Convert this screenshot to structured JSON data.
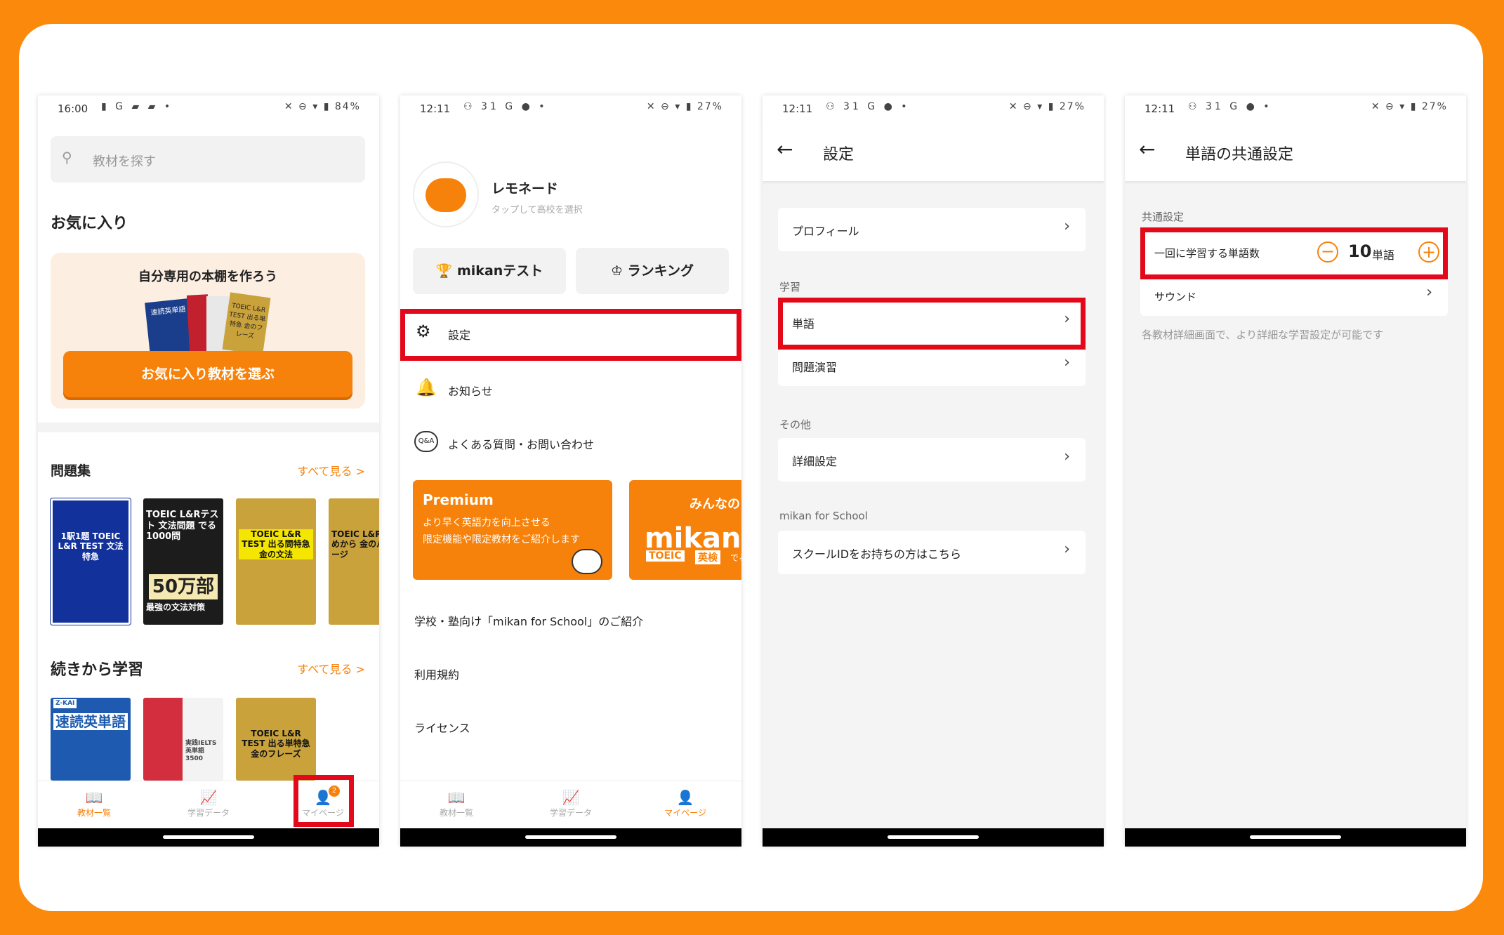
{
  "status": {
    "p1": {
      "time": "16:00",
      "left": "▮ G ▰ ▰ •",
      "right": "✕ ⊖ ▾ ▮ 84%"
    },
    "p2": {
      "time": "12:11",
      "left": "⚇ 31 G ● •",
      "right": "✕ ⊖ ▾ ▮ 27%"
    },
    "p3": {
      "time": "12:11",
      "left": "⚇ 31 G ● •",
      "right": "✕ ⊖ ▾ ▮ 27%"
    },
    "p4": {
      "time": "12:11",
      "left": "⚇ 31 G ● •",
      "right": "✕ ⊖ ▾ ▮ 27%"
    }
  },
  "tabs": {
    "books": "教材一覧",
    "stats": "学習データ",
    "mypage": "マイページ",
    "badge": "2"
  },
  "p1": {
    "search_placeholder": "教材を探す",
    "favorites_title": "お気に入り",
    "bookshelf_text": "自分専用の本棚を作ろう",
    "select_button": "お気に入り教材を選ぶ",
    "workbooks_title": "問題集",
    "see_all": "すべて見る >",
    "continue_title": "続きから学習",
    "books": [
      "1駅1題 TOEIC L&R TEST 文法特急",
      "TOEIC L&Rテスト 文法問題 でる1000問",
      "TOEIC L&R TEST 出る問特急 金の文法",
      "TOEIC L&R はじめから 金のパッケージ"
    ],
    "books2": [
      "速読英単語",
      "実践IELTS 英単語3500",
      "TOEIC L&R TEST 出る単特急 金のフレーズ"
    ],
    "mini_covers": [
      "速読英単語",
      "TOEIC L&R TEST 出る単特急 金のフレーズ"
    ],
    "fifty": "50万部",
    "strongest": "最強の文法対策",
    "zkai": "Z-KAI"
  },
  "p2": {
    "user_name": "レモネード",
    "user_sub": "タップして高校を選択",
    "mikan_test": "mikanテスト",
    "ranking": "ランキング",
    "settings": "設定",
    "news": "お知らせ",
    "faq": "よくある質問・お問い合わせ",
    "premium_title": "Premium",
    "premium_text1": "より早く英語力を向上させる",
    "premium_text2": "限定機能や限定教材をご紹介します",
    "banner2_top": "みんなの",
    "banner2_main": "mikan体",
    "banner2_tag1": "TOEIC",
    "banner2_tag2": "英検",
    "banner2_tail": "でる",
    "school_intro": "学校・塾向け「mikan for School」のご紹介",
    "terms": "利用規約",
    "license": "ライセンス"
  },
  "p3": {
    "title": "設定",
    "profile": "プロフィール",
    "sec_study": "学習",
    "words": "単語",
    "practice": "問題演習",
    "sec_other": "その他",
    "detail": "詳細設定",
    "sec_school": "mikan for School",
    "school_id": "スクールIDをお持ちの方はこちら"
  },
  "p4": {
    "title": "単語の共通設定",
    "sec_common": "共通設定",
    "words_per_session": "一回に学習する単語数",
    "count": "10",
    "unit": "単語",
    "sound": "サウンド",
    "note": "各教材詳細画面で、より詳細な学習設定が可能です"
  },
  "colors": {
    "accent": "#f7820b",
    "highlight": "#e3091a",
    "frame": "#fb8a0c"
  }
}
